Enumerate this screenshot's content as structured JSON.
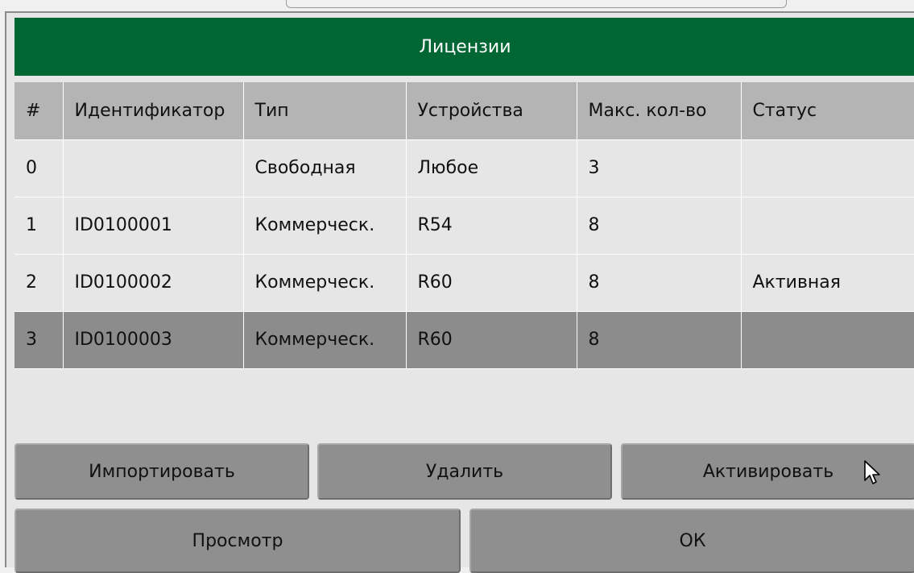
{
  "dialog": {
    "title": "Лицензии"
  },
  "table": {
    "columns": [
      "#",
      "Идентификатор",
      "Тип",
      "Устройства",
      "Макс. кол-во",
      "Статус"
    ],
    "rows": [
      [
        "0",
        "",
        "Свободная",
        "Любое",
        "3",
        ""
      ],
      [
        "1",
        "ID0100001",
        "Коммерческ.",
        "R54",
        "8",
        ""
      ],
      [
        "2",
        "ID0100002",
        "Коммерческ.",
        "R60",
        "8",
        "Активная"
      ],
      [
        "3",
        "ID0100003",
        "Коммерческ.",
        "R60",
        "8",
        ""
      ]
    ],
    "selected_row": 3
  },
  "buttons": {
    "import": "Импортировать",
    "delete": "Удалить",
    "activate": "Активировать",
    "view": "Просмотр",
    "ok": "ОК"
  },
  "colors": {
    "title_bar": "#006633",
    "header_row": "#b4b4b4",
    "row": "#e6e6e6",
    "selected_row": "#8c8c8c",
    "button": "#8f8f8f"
  },
  "icons": {
    "cursor": "mouse-pointer-icon"
  }
}
